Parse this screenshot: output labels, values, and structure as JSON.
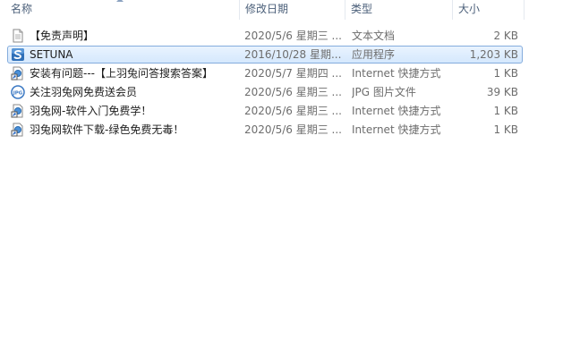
{
  "columns": {
    "name": "名称",
    "date": "修改日期",
    "type": "类型",
    "size": "大小"
  },
  "files": [
    {
      "name": "【免责声明】",
      "date": "2020/5/6 星期三 ...",
      "type": "文本文档",
      "size": "2 KB",
      "icon": "text-document-icon"
    },
    {
      "name": "SETUNA",
      "date": "2016/10/28 星期...",
      "type": "应用程序",
      "size": "1,203 KB",
      "icon": "setuna-app-icon"
    },
    {
      "name": "安装有问题---【上羽兔问答搜索答案】",
      "date": "2020/5/7 星期四 ...",
      "type": "Internet 快捷方式",
      "size": "1 KB",
      "icon": "internet-shortcut-icon"
    },
    {
      "name": "关注羽兔网免费送会员",
      "date": "2020/5/6 星期三 ...",
      "type": "JPG 图片文件",
      "size": "39 KB",
      "icon": "jpg-image-icon"
    },
    {
      "name": "羽兔网-软件入门免费学！",
      "date": "2020/5/6 星期三 ...",
      "type": "Internet 快捷方式",
      "size": "1 KB",
      "icon": "internet-shortcut-icon"
    },
    {
      "name": "羽兔网软件下载-绿色免费无毒！",
      "date": "2020/5/6 星期三 ...",
      "type": "Internet 快捷方式",
      "size": "1 KB",
      "icon": "internet-shortcut-icon"
    }
  ],
  "selected_row": 1,
  "colors": {
    "selection_bg": "#d5e8fd",
    "selection_border": "#84acdd",
    "header_text": "#4c607a"
  }
}
